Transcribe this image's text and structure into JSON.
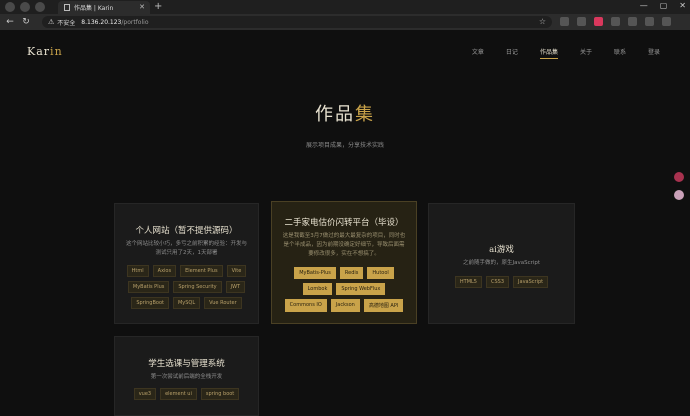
{
  "browser": {
    "tab_title": "作品集 | Karin",
    "insecure_label": "不安全",
    "url_host": "8.136.20.123",
    "url_path": "/portfolio"
  },
  "site": {
    "logo_main": "Kar",
    "logo_accent": "in",
    "nav": [
      "文章",
      "日记",
      "作品集",
      "关于",
      "联系",
      "登录"
    ],
    "active_nav": "作品集"
  },
  "hero": {
    "title_main": "作品",
    "title_accent": "集",
    "subtitle": "展示项目成果，分享技术实践"
  },
  "projects": [
    {
      "title": "个人网站（暂不提供源码）",
      "desc": "这个网站比较小巧，多亏之前积累的经验：开发与测试只用了2天，1天部署",
      "tags": [
        "Html",
        "Axios",
        "Element Plus",
        "Vite",
        "MyBatis Plus",
        "Spring Security",
        "JWT",
        "SpringBoot",
        "MySQL",
        "Vue Router"
      ]
    },
    {
      "title": "二手家电估价闪转平台（毕设）",
      "desc": "这是我截至3月7做过的最大最复杂的项目，同时也是个半成品，因为前期没确定好细节，导致后面需要修改很多，实在不想搞了。",
      "tags": [
        "MyBatis-Plus",
        "Redis",
        "Hutool",
        "Lombok",
        "Spring WebFlux",
        "Commons IO",
        "Jackson",
        "高德地图 API"
      ]
    },
    {
      "title": "ai游戏",
      "desc": "之前随手做的，原生JavaScript",
      "tags": [
        "HTML5",
        "CSS3",
        "JavaScript"
      ]
    },
    {
      "title": "学生选课与管理系统",
      "desc": "第一次尝试前后端的全栈开发",
      "tags": [
        "vue3",
        "element ui",
        "spring boot"
      ]
    }
  ]
}
